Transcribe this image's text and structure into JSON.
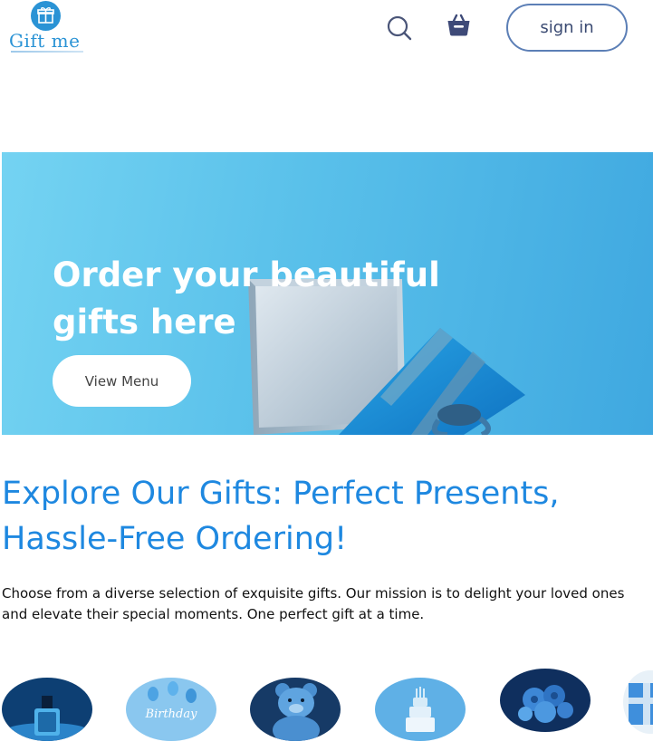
{
  "header": {
    "logo_text": "Gift me",
    "sign_in_label": "sign in",
    "icons": [
      "gift-icon",
      "search-icon",
      "cart-icon"
    ]
  },
  "hero": {
    "title": "Order your beautiful gifts here",
    "button_label": "View Menu"
  },
  "explore": {
    "title": "Explore Our Gifts: Perfect Presents, Hassle-Free Ordering!",
    "text": "Choose from a diverse selection of exquisite gifts. Our mission is to delight your loved ones and elevate their special moments. One perfect gift at a time."
  },
  "categories": [
    {
      "name": "perfume"
    },
    {
      "name": "birthday",
      "label": "Birthday"
    },
    {
      "name": "teddy-bear"
    },
    {
      "name": "cake"
    },
    {
      "name": "flowers"
    },
    {
      "name": "gift-box"
    }
  ],
  "colors": {
    "brand": "#2a93d5",
    "heading": "#1e88e0",
    "hero": "#59c0ea",
    "sign_in_border": "#5c7fb6"
  }
}
